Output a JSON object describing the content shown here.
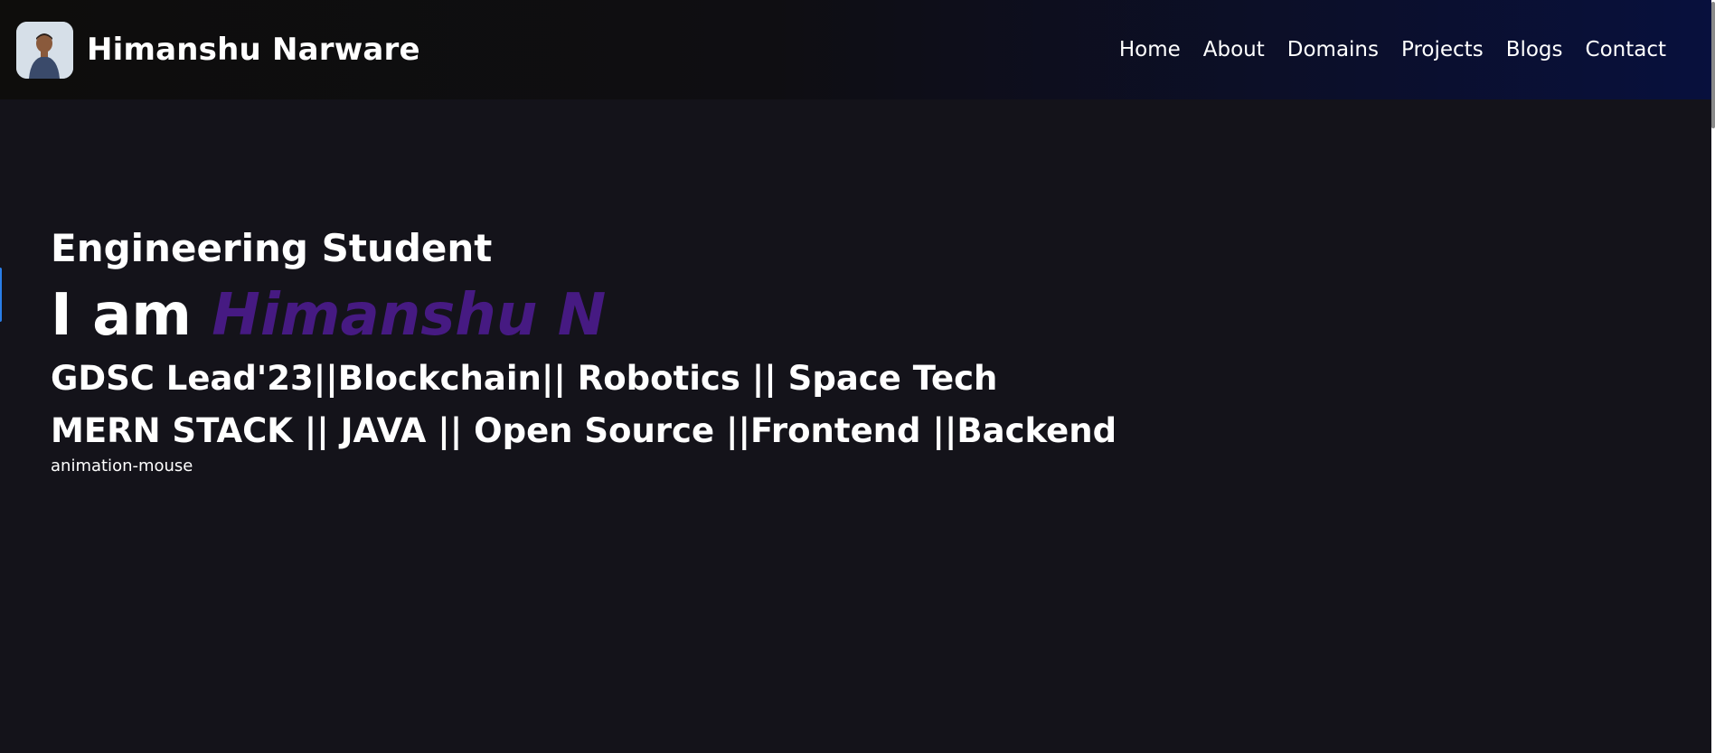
{
  "brand": {
    "name": "Himanshu Narware",
    "avatar_icon": "profile-photo-icon"
  },
  "nav": {
    "items": [
      {
        "label": "Home"
      },
      {
        "label": "About"
      },
      {
        "label": "Domains"
      },
      {
        "label": "Projects"
      },
      {
        "label": "Blogs"
      },
      {
        "label": "Contact"
      }
    ]
  },
  "hero": {
    "subtitle": "Engineering Student",
    "greeting": "I am",
    "name": "Himanshu N",
    "line1": "GDSC Lead'23||Blockchain|| Robotics || Space Tech",
    "line2": "MERN STACK || JAVA || Open Source ||Frontend ||Backend",
    "mouse_alt": "animation-mouse"
  },
  "colors": {
    "background": "#14131a",
    "accent_name": "#461a82",
    "nav_gradient_end": "#08103d"
  }
}
